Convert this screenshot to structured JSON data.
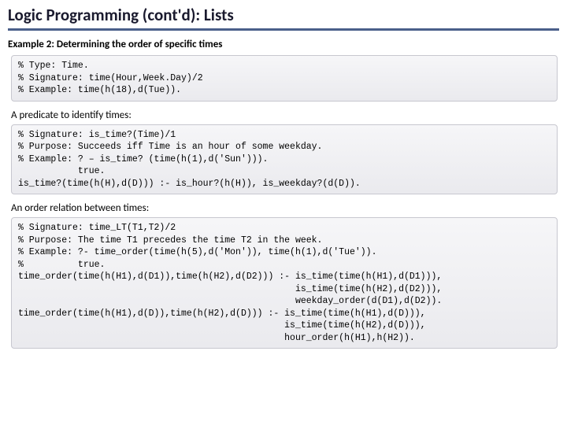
{
  "title": "Logic Programming (cont'd):   Lists",
  "subtitle": "Example 2:  Determining the order of specific times",
  "block1": {
    "code": "% Type: Time.\n% Signature: time(Hour,Week.Day)/2\n% Example: time(h(18),d(Tue))."
  },
  "heading2": "A predicate to identify times:",
  "block2": {
    "code": "% Signature: is_time?(Time)/1\n% Purpose: Succeeds iff Time is an hour of some weekday.\n% Example: ? – is_time? (time(h(1),d('Sun'))).\n           true.\nis_time?(time(h(H),d(D))) :- is_hour?(h(H)), is_weekday?(d(D))."
  },
  "heading3": "An order relation between times:",
  "block3": {
    "code": "% Signature: time_LT(T1,T2)/2\n% Purpose: The time T1 precedes the time T2 in the week.\n% Example: ?- time_order(time(h(5),d('Mon')), time(h(1),d('Tue')).\n%          true.\ntime_order(time(h(H1),d(D1)),time(h(H2),d(D2))) :- is_time(time(h(H1),d(D1))),\n                                                   is_time(time(h(H2),d(D2))),\n                                                   weekday_order(d(D1),d(D2)).\ntime_order(time(h(H1),d(D)),time(h(H2),d(D))) :- is_time(time(h(H1),d(D))),\n                                                 is_time(time(h(H2),d(D))),\n                                                 hour_order(h(H1),h(H2))."
  }
}
